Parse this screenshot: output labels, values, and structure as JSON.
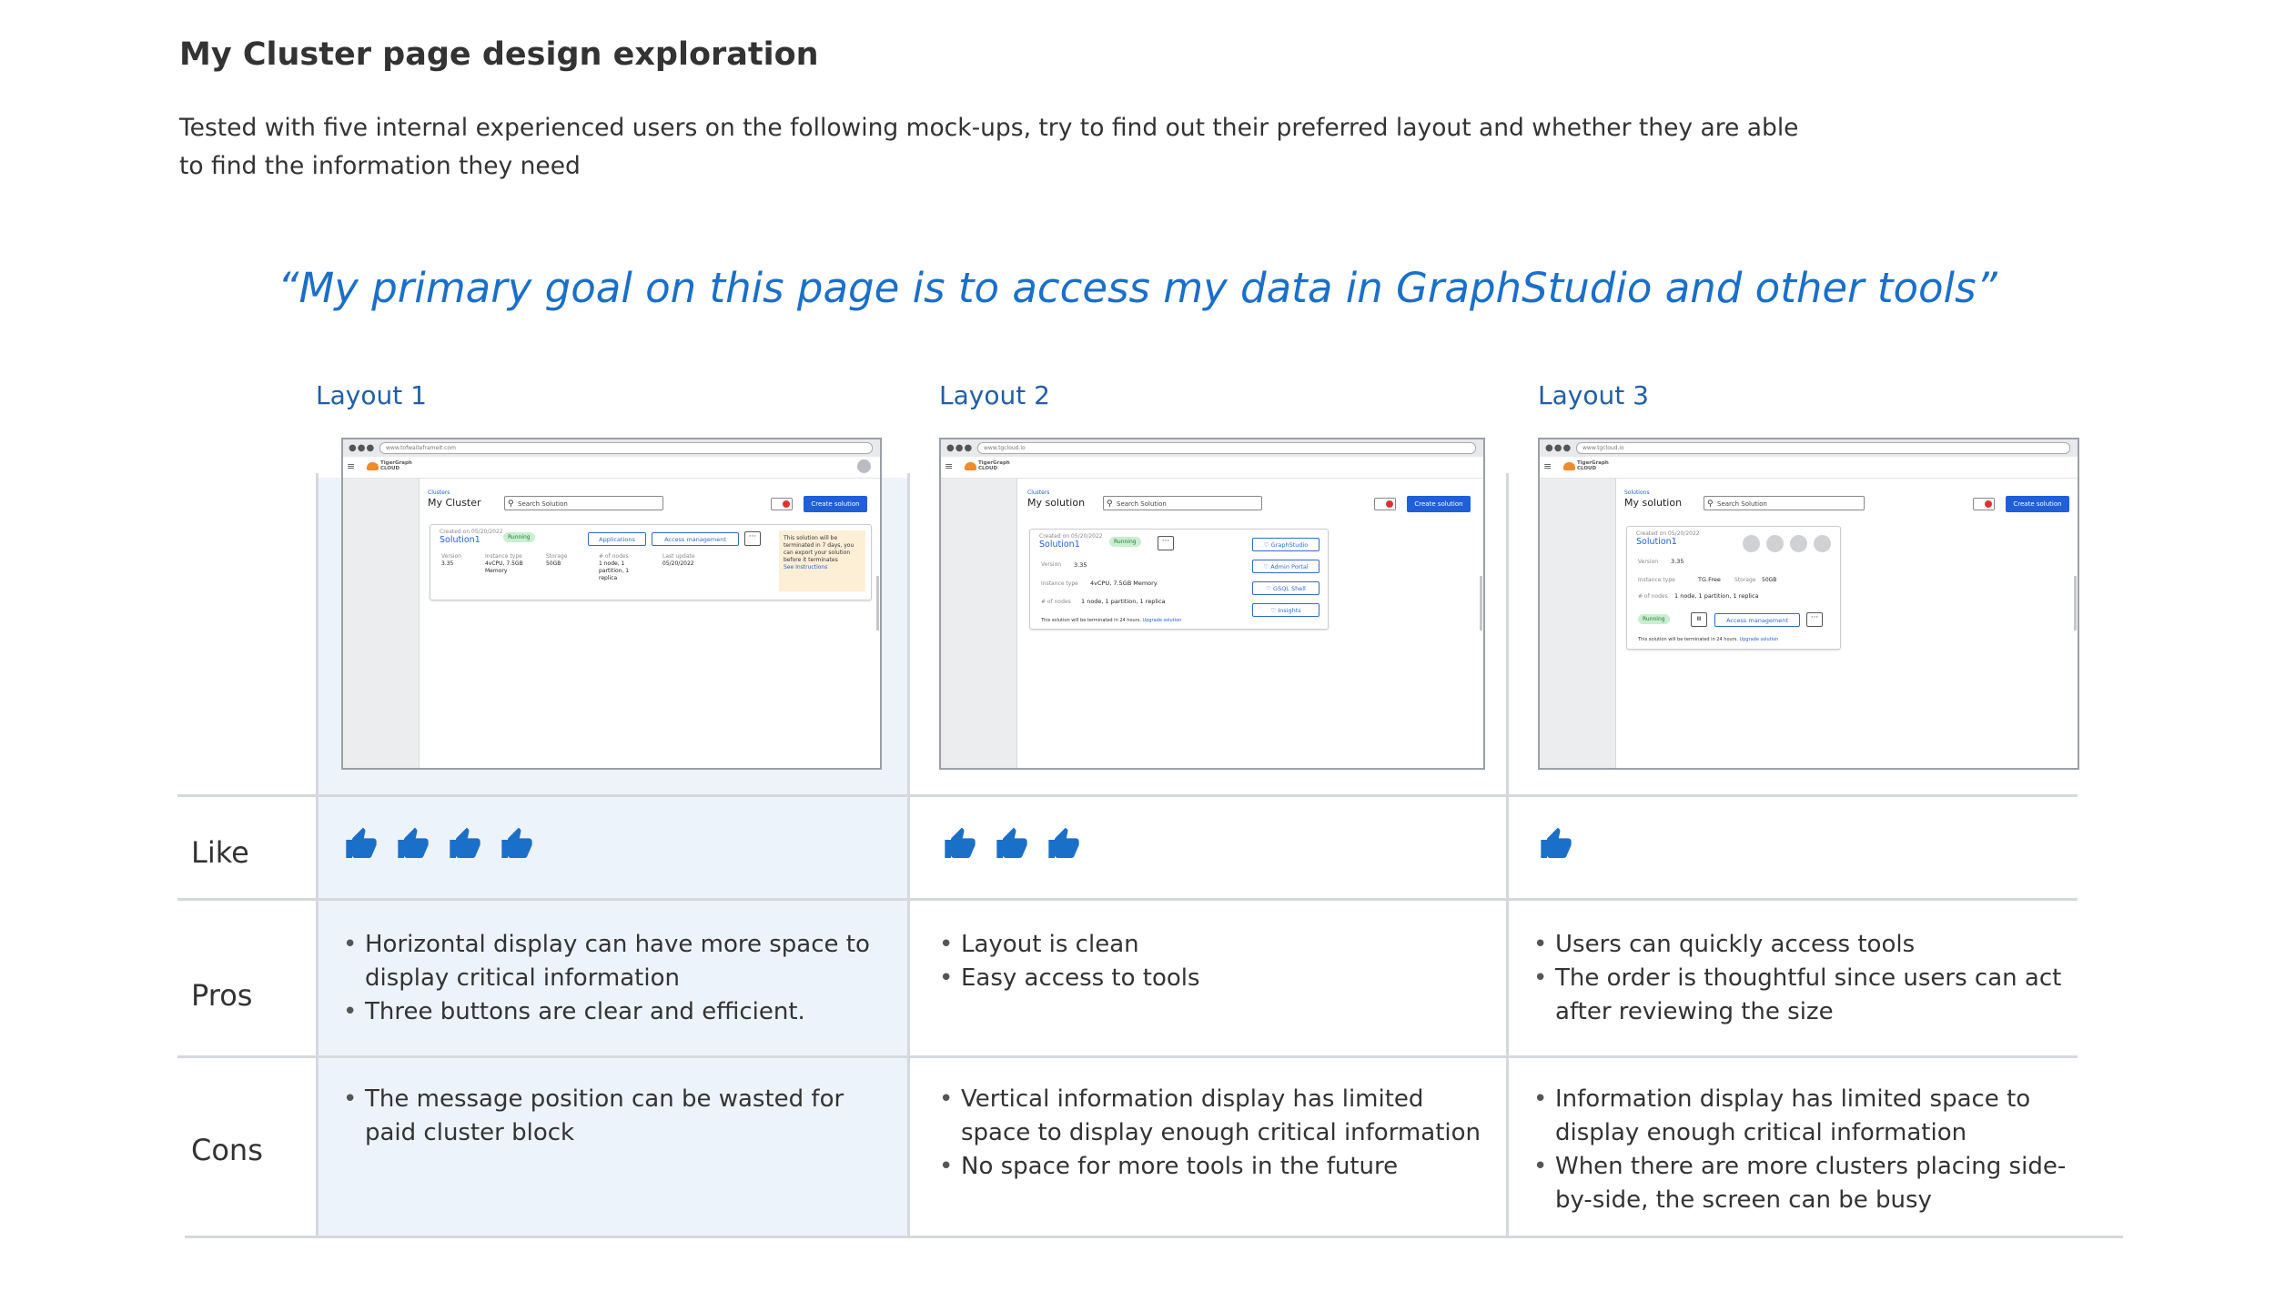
{
  "title": "My Cluster page design exploration",
  "intro": "Tested with five internal experienced users on the following mock-ups, try to find out their preferred layout and whether they are able to find the information they need",
  "quote": "“My primary goal on this page is to access my data in GraphStudio and other tools”",
  "row_labels": {
    "like": "Like",
    "pros": "Pros",
    "cons": "Cons"
  },
  "colors": {
    "accent": "#1a6fc9",
    "highlight": "#edf3fb",
    "thumb": "#1a6fc9"
  },
  "layouts": [
    {
      "label": "Layout 1",
      "likes": 4,
      "pros": [
        "Horizontal display can have more space to display critical information",
        "Three buttons are clear and efficient."
      ],
      "cons": [
        "The message position can be wasted for paid cluster block"
      ]
    },
    {
      "label": "Layout 2",
      "likes": 3,
      "pros": [
        "Layout is clean",
        "Easy access to tools"
      ],
      "cons": [
        "Vertical information display has limited space to display enough critical information",
        "No space for more tools in the future"
      ]
    },
    {
      "label": "Layout 3",
      "likes": 1,
      "pros": [
        "Users can quickly access tools",
        "The order is thoughtful since users can act after reviewing the size"
      ],
      "cons": [
        "Information display has limited space to display enough critical information",
        "When there are more clusters placing side-by-side, the screen can be busy"
      ]
    }
  ],
  "mock1": {
    "url": "www.tofwaiteframeit.com",
    "logo": "TigerGraph CLOUD",
    "breadcrumb": "Clusters",
    "heading": "My Cluster",
    "search": "Search Solution",
    "create": "Create solution",
    "created": "Created on 05/20/2022",
    "solution": "Solution1",
    "status": "Running",
    "btn_apps": "Applications",
    "btn_access": "Access management",
    "more": "···",
    "f1_label": "Version",
    "f1_value": "3.35",
    "f2_label": "Instance type",
    "f2_value": "4vCPU, 7.5GB Memory",
    "f3_label": "Storage",
    "f3_value": "50GB",
    "f4_label": "# of nodes",
    "f4_value": "1 node, 1 partition, 1 replica",
    "f5_label": "Last update",
    "f5_value": "05/20/2022",
    "note": "This solution will be terminated in 7 days, you can export your solution before it terminates",
    "note_link": "See Instructions"
  },
  "mock2": {
    "url": "www.tgcloud.io",
    "logo": "TigerGraph CLOUD",
    "breadcrumb": "Clusters",
    "heading": "My solution",
    "search": "Search Solution",
    "create": "Create solution",
    "created": "Created on 05/20/2022",
    "solution": "Solution1",
    "status": "Running",
    "more": "···",
    "f1_label": "Version",
    "f1_value": "3.35",
    "f2_label": "Instance type",
    "f2_value": "4vCPU, 7.5GB Memory",
    "f3_label": "# of nodes",
    "f3_value": "1 node, 1 partition, 1 replica",
    "tools": [
      "GraphStudio",
      "Admin Portal",
      "GSQL Shell",
      "Insights"
    ],
    "footer": "This solution will be terminated in 24 hours.",
    "footer_link": "Upgrade solution"
  },
  "mock3": {
    "url": "www.tgcloud.io",
    "logo": "TigerGraph CLOUD",
    "breadcrumb": "Solutions",
    "heading": "My solution",
    "search": "Search Solution",
    "create": "Create solution",
    "created": "Created on 05/20/2022",
    "solution": "Solution1",
    "f1_label": "Version",
    "f1_value": "3.35",
    "f2_label": "Instance type",
    "f2_value": "TG.Free",
    "f3_label": "Storage",
    "f3_value": "50GB",
    "f4_label": "# of nodes",
    "f4_value": "1 node, 1 partition, 1 replica",
    "status": "Running",
    "pause": "II",
    "btn_access": "Access management",
    "more": "···",
    "footer": "This solution will be terminated in 24 hours.",
    "footer_link": "Upgrade solution"
  }
}
